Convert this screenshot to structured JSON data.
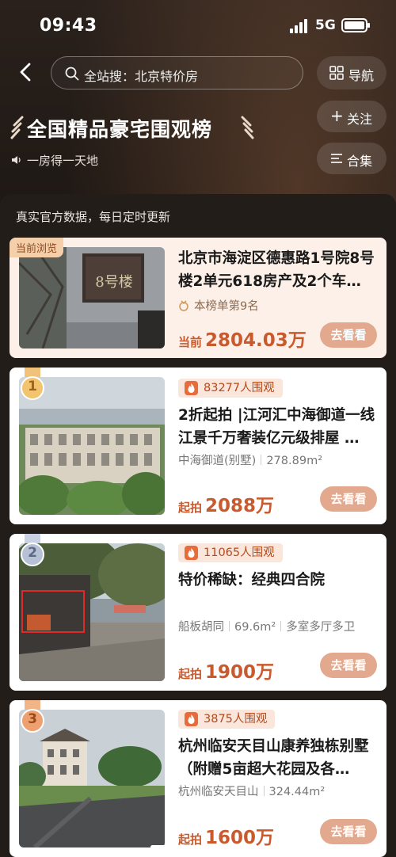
{
  "status_bar": {
    "time": "09:43",
    "network": "5G"
  },
  "header": {
    "search_placeholder": "全站搜：北京特价房",
    "nav_label": "导航",
    "title": "全国精品豪宅围观榜",
    "subtitle": "一房得一天地",
    "follow_label": "关注",
    "collection_label": "合集"
  },
  "list": {
    "note": "真实官方数据，每日定时更新",
    "current": {
      "tag": "当前浏览",
      "title": "北京市海淀区德惠路1号院8号楼2单元618房产及2个车…",
      "rank_text": "本榜单第9名",
      "price_label": "当前",
      "price_value": "2804.03万",
      "button": "去看看"
    },
    "items": [
      {
        "rank": "1",
        "views": "83277人围观",
        "title": "2折起拍 |江河汇中海御道一线江景千万奢装亿元级排屋 …",
        "meta": [
          "中海御道(别墅)",
          "278.89m²"
        ],
        "price_label": "起拍",
        "price_value": "2088万",
        "button": "去看看"
      },
      {
        "rank": "2",
        "views": "11065人围观",
        "title": "特价稀缺：经典四合院",
        "meta": [
          "船板胡同",
          "69.6m²",
          "多室多厅多卫"
        ],
        "price_label": "起拍",
        "price_value": "1900万",
        "button": "去看看"
      },
      {
        "rank": "3",
        "views": "3875人围观",
        "title": "杭州临安天目山康养独栋别墅（附赠5亩超大花园及各…",
        "meta": [
          "杭州临安天目山",
          "324.44m²"
        ],
        "price_label": "起拍",
        "price_value": "1600万",
        "button": "去看看"
      }
    ]
  },
  "colors": {
    "accent": "#c85a2e",
    "button": "#e2a98f",
    "gold": "#e8b15a",
    "silver": "#aab3c8",
    "bronze": "#e0925a"
  },
  "icons": [
    "back-arrow-icon",
    "search-icon",
    "grid-icon",
    "laurel-icon",
    "speaker-icon",
    "plus-icon",
    "list-icon",
    "medal-icon",
    "flame-icon",
    "rank-badge-icon"
  ]
}
